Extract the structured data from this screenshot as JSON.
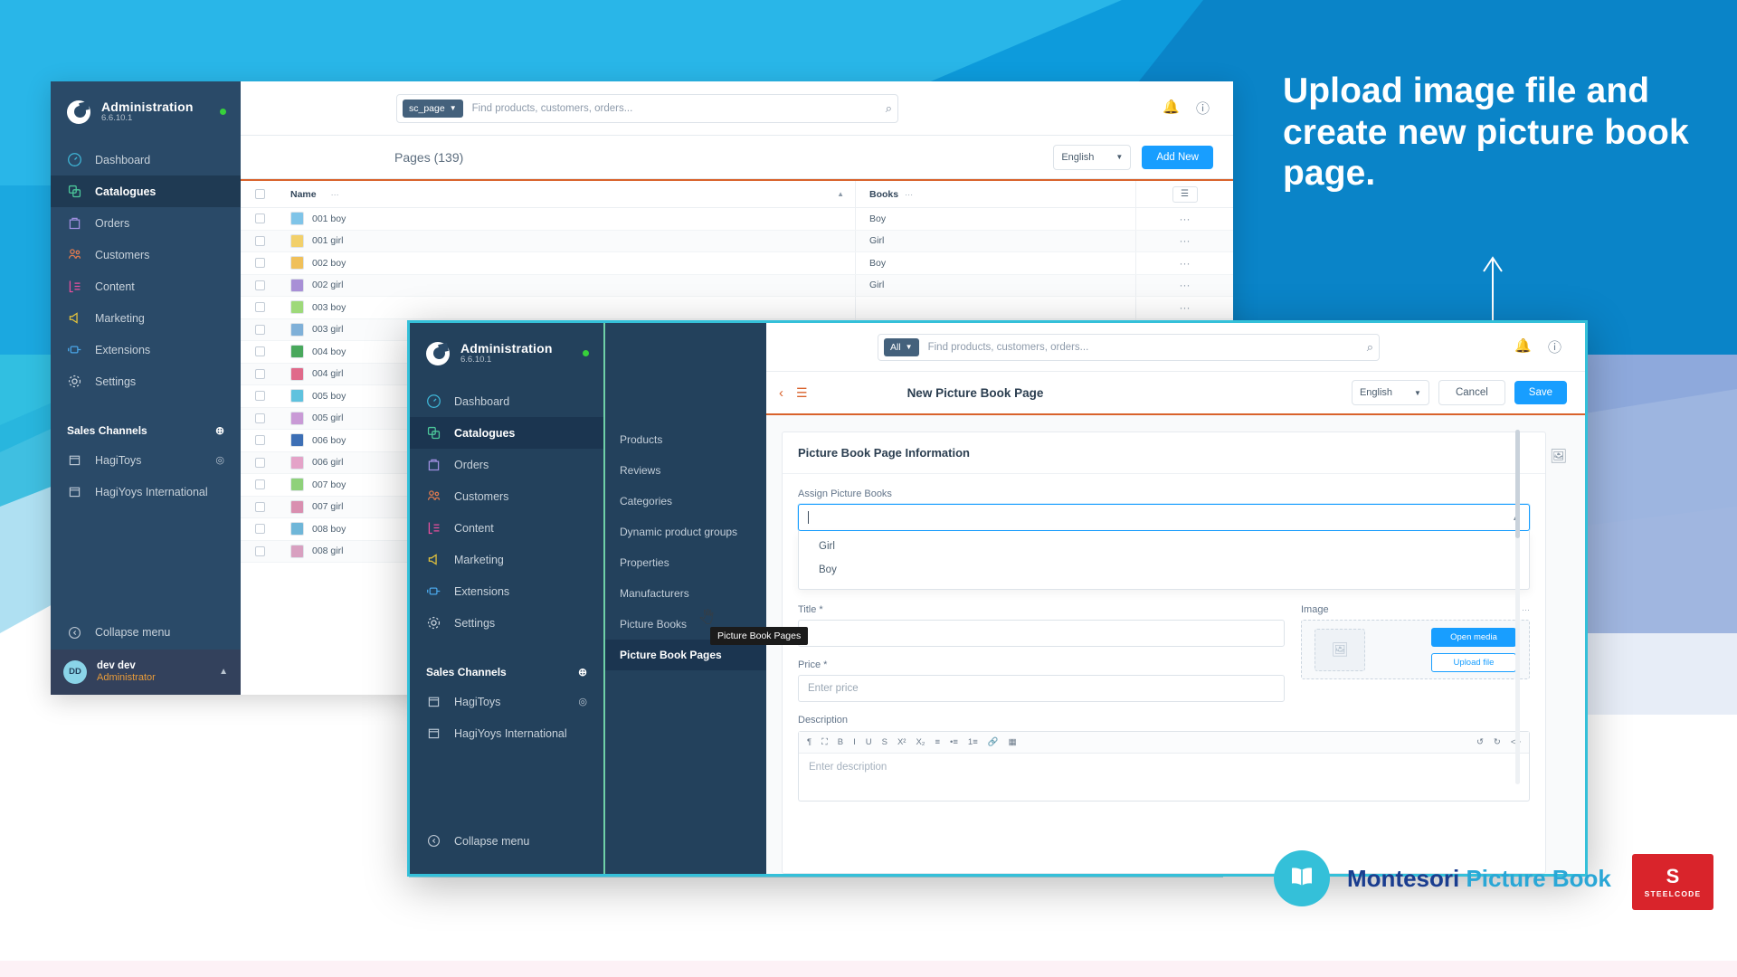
{
  "overlay": {
    "headline": "Upload image file and create new picture book page.",
    "brand_primary": "Montesori",
    "brand_secondary": "Picture Book",
    "company_mark": "S",
    "company_name": "STEELCODE",
    "accent_cyan": "#34c0d9",
    "accent_blue": "#189eff",
    "brand_navy": "#1a3d8f"
  },
  "background_window": {
    "sidebar": {
      "brand_title": "Administration",
      "version": "6.6.10.1",
      "items": [
        {
          "label": "Dashboard",
          "icon": "gauge-icon"
        },
        {
          "label": "Catalogues",
          "icon": "catalogue-icon"
        },
        {
          "label": "Orders",
          "icon": "bag-icon"
        },
        {
          "label": "Customers",
          "icon": "people-icon"
        },
        {
          "label": "Content",
          "icon": "content-icon"
        },
        {
          "label": "Marketing",
          "icon": "megaphone-icon"
        },
        {
          "label": "Extensions",
          "icon": "plug-icon"
        },
        {
          "label": "Settings",
          "icon": "gear-icon"
        }
      ],
      "active_item": "Catalogues",
      "sales_channels_label": "Sales Channels",
      "channels": [
        {
          "label": "HagiToys"
        },
        {
          "label": "HagiYoys International"
        }
      ],
      "collapse_label": "Collapse menu",
      "user_initials": "DD",
      "user_name": "dev dev",
      "user_role": "Administrator"
    },
    "topbar": {
      "scope_pill": "sc_page",
      "search_placeholder": "Find products, customers, orders..."
    },
    "subbar": {
      "title": "Pages",
      "count": "(139)",
      "language": "English",
      "add_new_label": "Add New"
    },
    "table": {
      "columns": [
        "Name",
        "Books"
      ],
      "rows": [
        {
          "name": "001 boy",
          "books": "Boy"
        },
        {
          "name": "001 girl",
          "books": "Girl"
        },
        {
          "name": "002 boy",
          "books": "Boy"
        },
        {
          "name": "002 girl",
          "books": "Girl"
        },
        {
          "name": "003 boy",
          "books": ""
        },
        {
          "name": "003 girl",
          "books": ""
        },
        {
          "name": "004 boy",
          "books": ""
        },
        {
          "name": "004 girl",
          "books": ""
        },
        {
          "name": "005 boy",
          "books": ""
        },
        {
          "name": "005 girl",
          "books": ""
        },
        {
          "name": "006 boy",
          "books": ""
        },
        {
          "name": "006 girl",
          "books": ""
        },
        {
          "name": "007 boy",
          "books": ""
        },
        {
          "name": "007 girl",
          "books": ""
        },
        {
          "name": "008 boy",
          "books": ""
        },
        {
          "name": "008 girl",
          "books": ""
        }
      ]
    }
  },
  "modal_window": {
    "sidebar": {
      "brand_title": "Administration",
      "version": "6.6.10.1",
      "items": [
        {
          "label": "Dashboard",
          "icon": "gauge-icon"
        },
        {
          "label": "Catalogues",
          "icon": "catalogue-icon"
        },
        {
          "label": "Orders",
          "icon": "bag-icon"
        },
        {
          "label": "Customers",
          "icon": "people-icon"
        },
        {
          "label": "Content",
          "icon": "content-icon"
        },
        {
          "label": "Marketing",
          "icon": "megaphone-icon"
        },
        {
          "label": "Extensions",
          "icon": "plug-icon"
        },
        {
          "label": "Settings",
          "icon": "gear-icon"
        }
      ],
      "active_item": "Catalogues",
      "sales_channels_label": "Sales Channels",
      "channels": [
        {
          "label": "HagiToys"
        },
        {
          "label": "HagiYoys International"
        }
      ],
      "collapse_label": "Collapse menu"
    },
    "submenu": {
      "items": [
        "Products",
        "Reviews",
        "Categories",
        "Dynamic product groups",
        "Properties",
        "Manufacturers",
        "Picture Books",
        "Picture Book Pages"
      ],
      "active_item": "Picture Book Pages",
      "tooltip": "Picture Book Pages"
    },
    "topbar": {
      "scope_pill": "All",
      "search_placeholder": "Find products, customers, orders..."
    },
    "subbar": {
      "title": "New Picture Book Page",
      "language": "English",
      "cancel_label": "Cancel",
      "save_label": "Save"
    },
    "form": {
      "card_title": "Picture Book Page Information",
      "assign_label": "Assign Picture Books",
      "assign_value": "",
      "assign_options": [
        "Girl",
        "Boy"
      ],
      "title_label": "Title *",
      "title_value": "",
      "price_label": "Price *",
      "price_placeholder": "Enter price",
      "image_label": "Image",
      "open_media_label": "Open media",
      "upload_file_label": "Upload file",
      "description_label": "Description",
      "description_placeholder": "Enter description",
      "editor_tools": [
        "¶",
        "⛶",
        "B",
        "I",
        "U",
        "S",
        "X²",
        "X₂",
        "≡",
        "•≡",
        "1≡",
        "🔗",
        "▦"
      ],
      "editor_tools_right": [
        "↺",
        "↻",
        "<>"
      ]
    }
  }
}
